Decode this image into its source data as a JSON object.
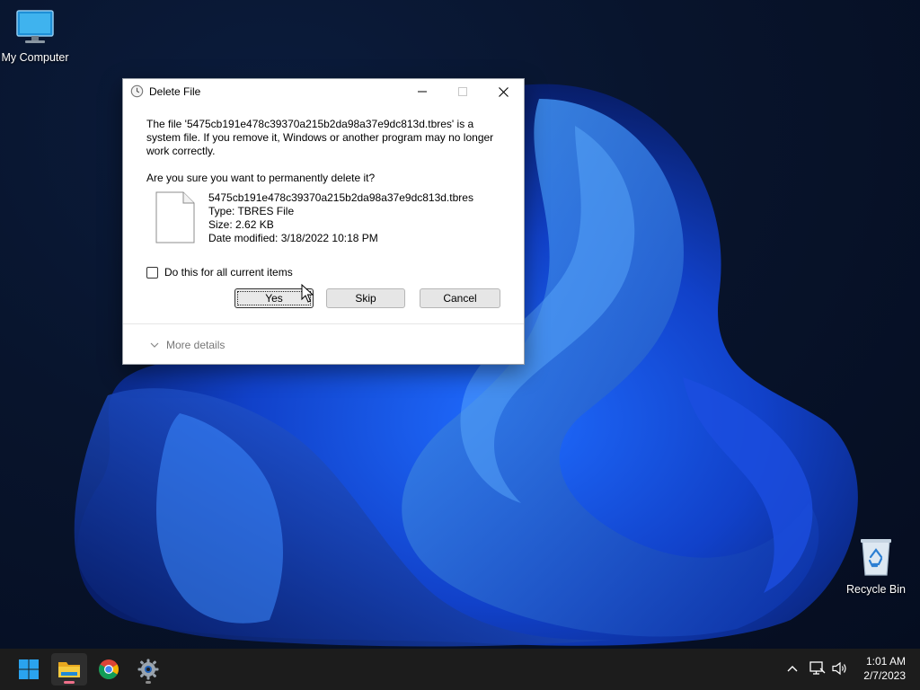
{
  "desktop": {
    "icons": [
      {
        "label": "My Computer",
        "icon": "monitor-icon"
      },
      {
        "label": "Recycle Bin",
        "icon": "recycle-bin-icon"
      }
    ]
  },
  "dialog": {
    "title": "Delete File",
    "message": "The file '5475cb191e478c39370a215b2da98a37e9dc813d.tbres' is a system file. If you remove it, Windows or another program may no longer work correctly.",
    "question": "Are you sure you want to permanently delete it?",
    "file": {
      "name": "5475cb191e478c39370a215b2da98a37e9dc813d.tbres",
      "type": "Type: TBRES File",
      "size": "Size: 2.62 KB",
      "modified": "Date modified: 3/18/2022 10:18 PM"
    },
    "checkbox_label": "Do this for all current items",
    "checkbox_checked": false,
    "buttons": {
      "yes": "Yes",
      "skip": "Skip",
      "cancel": "Cancel"
    },
    "more_details": "More details"
  },
  "taskbar": {
    "items": [
      {
        "name": "start-icon",
        "active": false
      },
      {
        "name": "file-explorer-icon",
        "active": true
      },
      {
        "name": "chrome-icon",
        "active": false
      },
      {
        "name": "settings-icon",
        "active": false
      }
    ],
    "clock": {
      "time": "1:01 AM",
      "date": "2/7/2023"
    }
  },
  "colors": {
    "accent": "#0078d4",
    "taskbar": "#1c1c1c",
    "desktop": "#08142c"
  }
}
